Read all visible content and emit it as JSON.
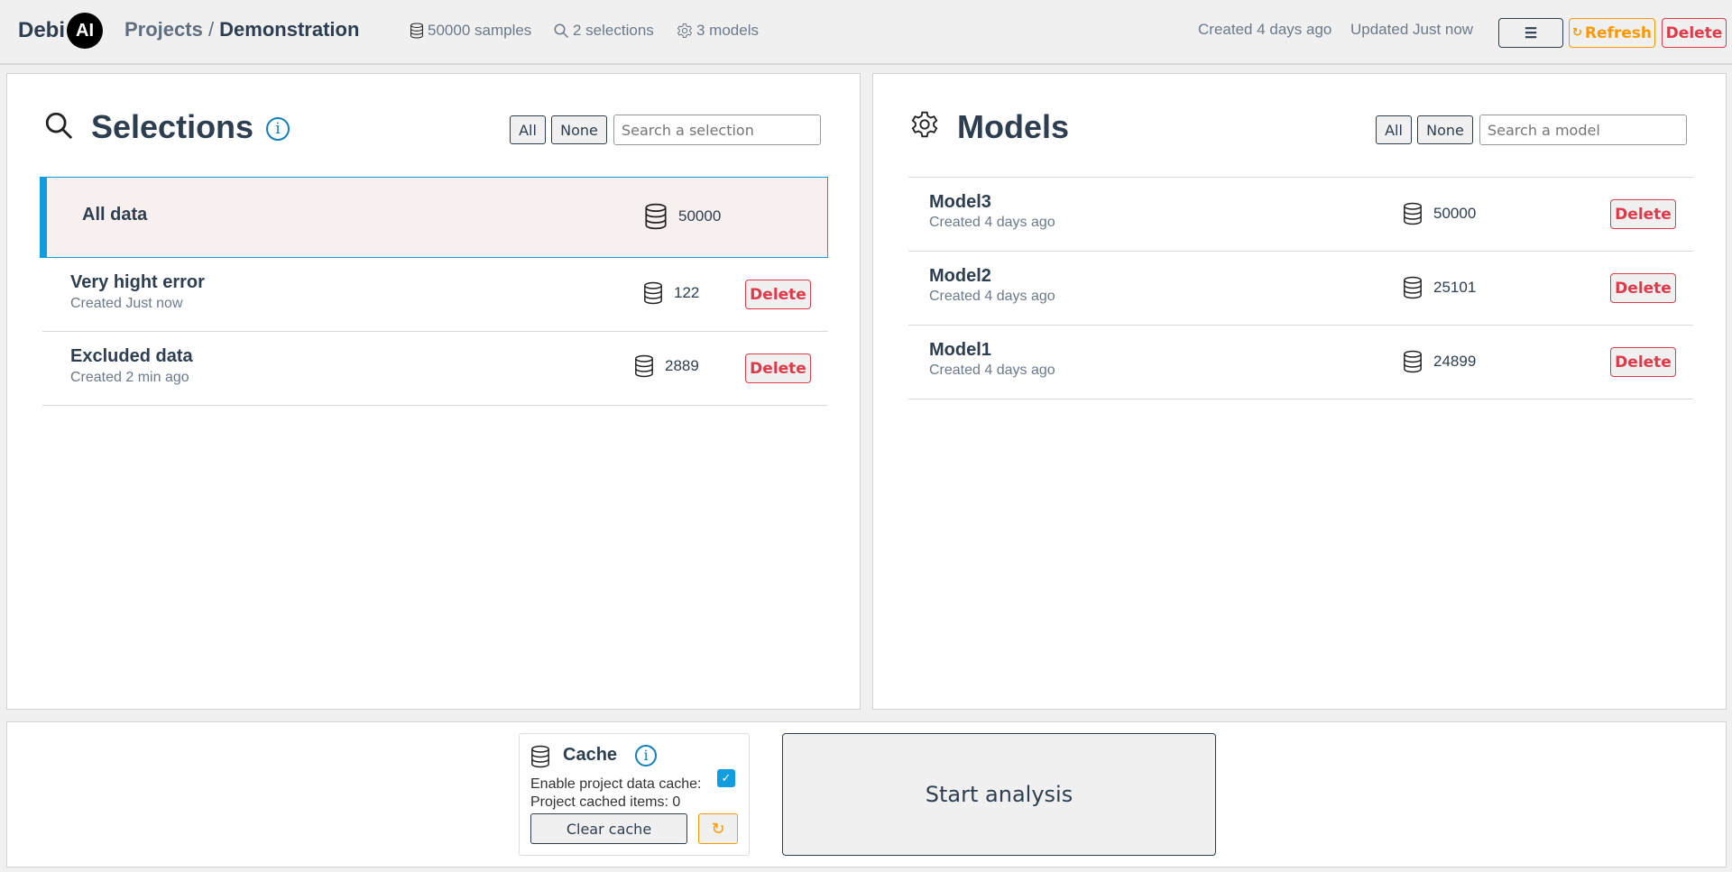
{
  "header": {
    "logo_text": "Debi",
    "logo_badge": "AI",
    "breadcrumb_root": "Projects",
    "breadcrumb_sep": " / ",
    "breadcrumb_current": "Demonstration",
    "samples": "50000 samples",
    "selections": "2 selections",
    "models": "3 models",
    "created": "Created 4 days ago",
    "updated": "Updated Just now",
    "refresh_label": "Refresh",
    "delete_label": "Delete"
  },
  "selections": {
    "title": "Selections",
    "all_label": "All",
    "none_label": "None",
    "search_placeholder": "Search a selection",
    "items": [
      {
        "name": "All data",
        "sub": "",
        "count": "50000",
        "selected": true
      },
      {
        "name": "Very hight error",
        "sub": "Created Just now",
        "count": "122",
        "delete": "Delete"
      },
      {
        "name": "Excluded data",
        "sub": "Created 2 min ago",
        "count": "2889",
        "delete": "Delete"
      }
    ]
  },
  "models": {
    "title": "Models",
    "all_label": "All",
    "none_label": "None",
    "search_placeholder": "Search a model",
    "items": [
      {
        "name": "Model3",
        "sub": "Created 4 days ago",
        "count": "50000",
        "delete": "Delete"
      },
      {
        "name": "Model2",
        "sub": "Created 4 days ago",
        "count": "25101",
        "delete": "Delete"
      },
      {
        "name": "Model1",
        "sub": "Created 4 days ago",
        "count": "24899",
        "delete": "Delete"
      }
    ]
  },
  "cache": {
    "title": "Cache",
    "enable_label": "Enable project data cache:",
    "enabled": true,
    "items_label": "Project cached items: 0",
    "clear_label": "Clear cache"
  },
  "start_label": "Start analysis",
  "colors": {
    "accent": "#0f9de0",
    "warning": "#ff9800",
    "danger": "#e03a4a",
    "text": "#2c3e50"
  }
}
